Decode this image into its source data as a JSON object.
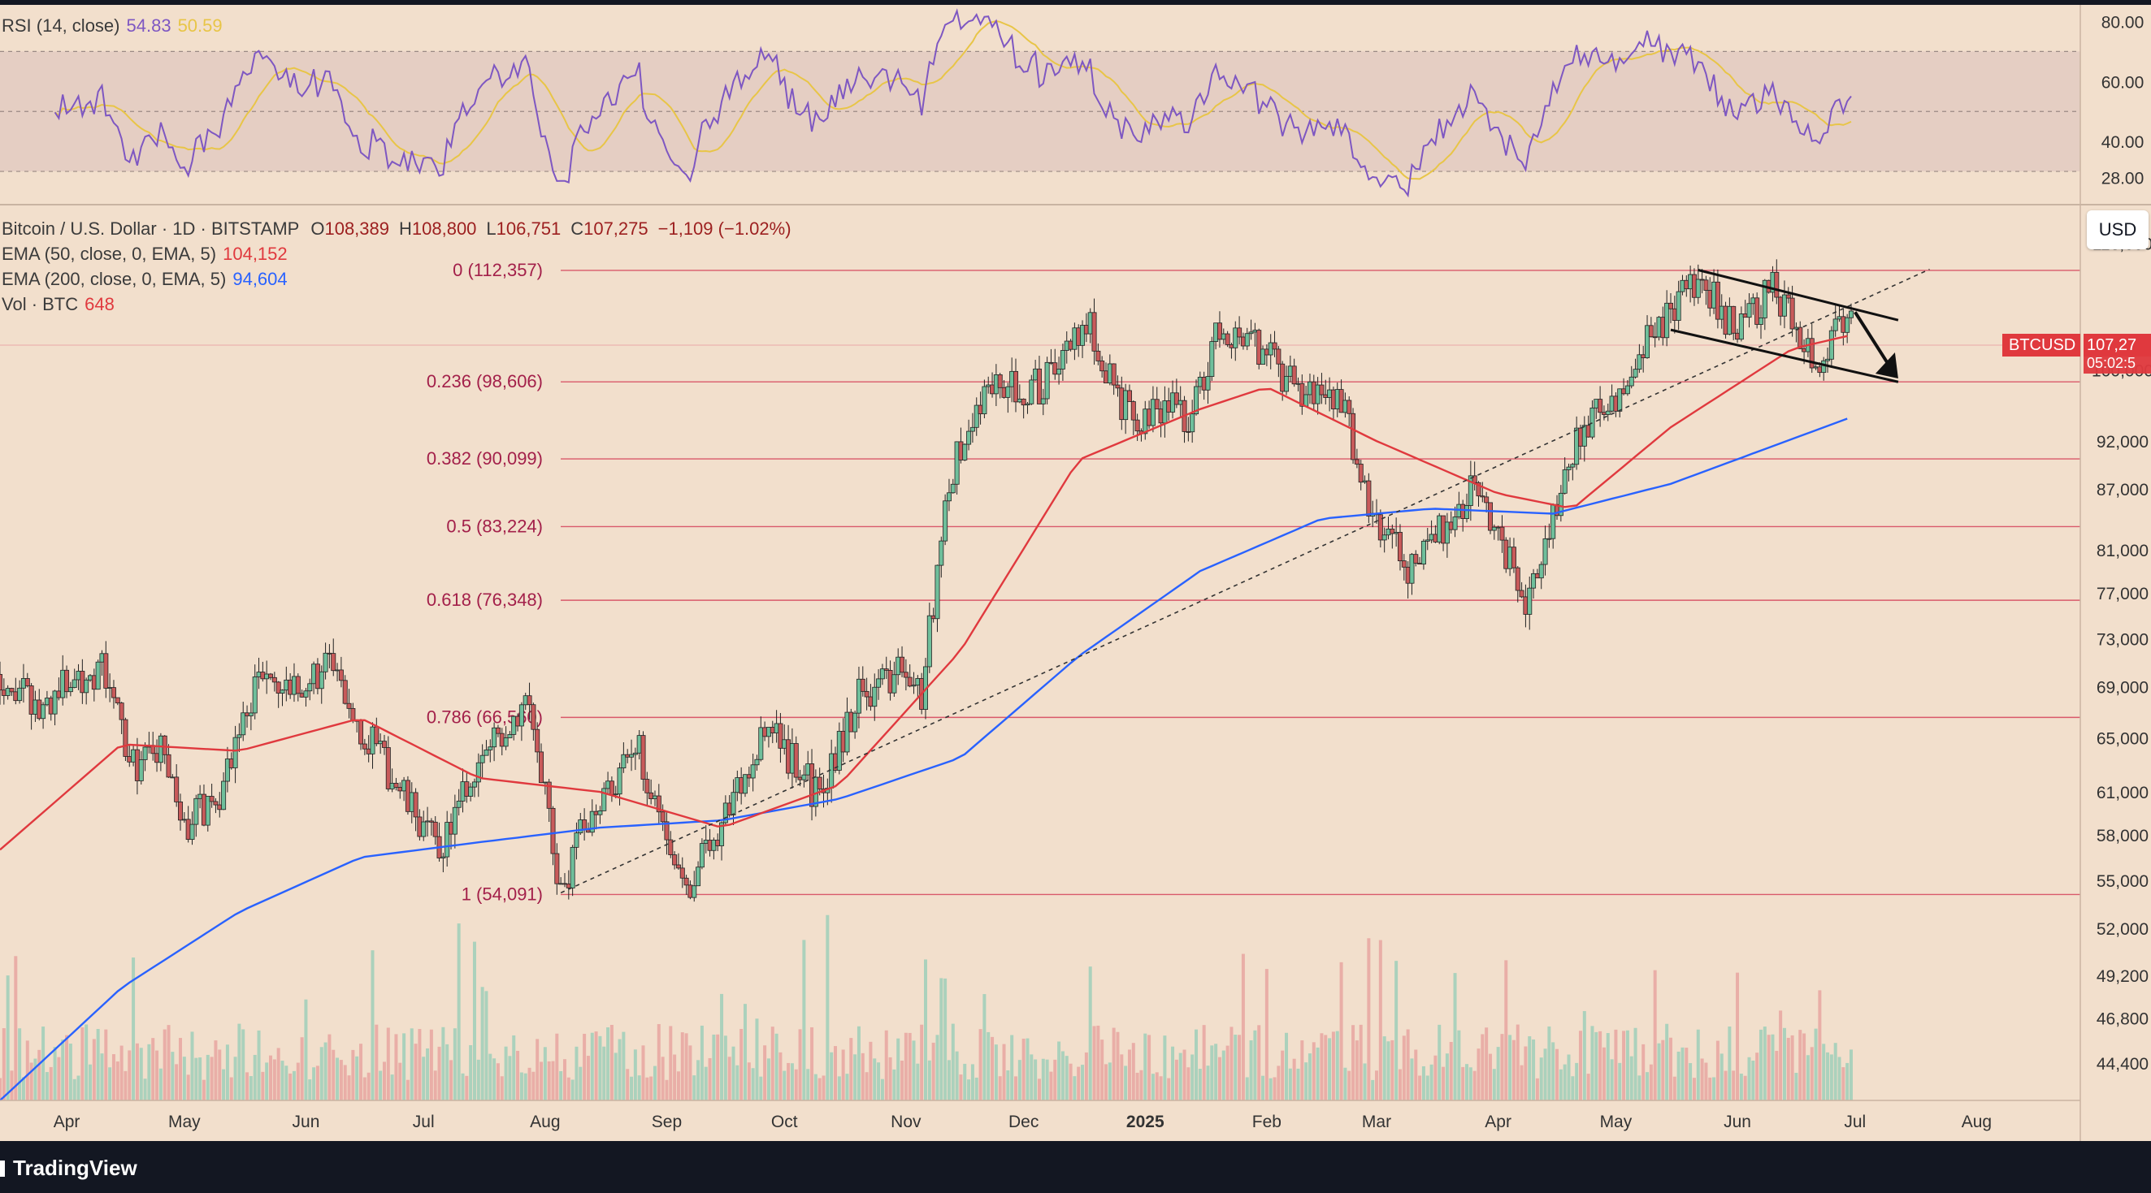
{
  "rsi": {
    "title": "RSI (14, close)",
    "value": "54.83",
    "ma_value": "50.59",
    "levels": [
      "80.00",
      "60.00",
      "40.00",
      "28.00"
    ],
    "colors": {
      "rsi": "#7e57c2",
      "ma": "#e8c547",
      "band": "#e0c8c0"
    }
  },
  "main": {
    "symbol_line": "Bitcoin / U.S. Dollar · 1D · BITSTAMP",
    "ohlc": {
      "open_label": "O",
      "open": "108,389",
      "high_label": "H",
      "high": "108,800",
      "low_label": "L",
      "low": "106,751",
      "close_label": "C",
      "close": "107,275",
      "change": "−1,109 (−1.02%)"
    },
    "ema50": {
      "label": "EMA (50, close, 0, EMA, 5)",
      "value": "104,152",
      "color": "#e0393e"
    },
    "ema200": {
      "label": "EMA (200, close, 0, EMA, 5)",
      "value": "94,604",
      "color": "#2962ff"
    },
    "vol": {
      "label": "Vol · BTC",
      "value": "648"
    },
    "currency_button": "USD",
    "ticker_label": "BTCUSD",
    "last_price": "107,27",
    "countdown": "05:02:5"
  },
  "price_axis": [
    "116,000",
    "100,000",
    "92,000",
    "87,000",
    "81,000",
    "77,000",
    "73,000",
    "69,000",
    "65,000",
    "61,000",
    "58,000",
    "55,000",
    "52,000",
    "49,200",
    "46,800",
    "44,400"
  ],
  "time_axis": [
    "Apr",
    "May",
    "Jun",
    "Jul",
    "Aug",
    "Sep",
    "Oct",
    "Nov",
    "Dec",
    "2025",
    "Feb",
    "Mar",
    "Apr",
    "May",
    "Jun",
    "Jul",
    "Aug"
  ],
  "footer": {
    "brand": "TradingView"
  },
  "chart_data": {
    "type": "candlestick",
    "x_range": [
      "2024-03-15",
      "2025-08-15"
    ],
    "y_axis_scale": "log",
    "ylim": [
      42500,
      121000
    ],
    "fibonacci_levels": [
      {
        "label": "0 (112,357)",
        "value": 112357
      },
      {
        "label": "0.236 (98,606)",
        "value": 98606
      },
      {
        "label": "0.382 (90,099)",
        "value": 90099
      },
      {
        "label": "0.5 (83,224)",
        "value": 83224
      },
      {
        "label": "0.618 (76,348)",
        "value": 76348
      },
      {
        "label": "0.786 (66,560)",
        "value": 66560
      },
      {
        "label": "1 (54,091)",
        "value": 54091
      }
    ],
    "price_path": [
      [
        "2024-03-15",
        70000
      ],
      [
        "2024-03-25",
        67000
      ],
      [
        "2024-04-01",
        69500
      ],
      [
        "2024-04-10",
        70500
      ],
      [
        "2024-04-18",
        63000
      ],
      [
        "2024-04-25",
        64000
      ],
      [
        "2024-05-01",
        58500
      ],
      [
        "2024-05-10",
        61000
      ],
      [
        "2024-05-20",
        70000
      ],
      [
        "2024-05-28",
        68000
      ],
      [
        "2024-06-06",
        71000
      ],
      [
        "2024-06-15",
        66000
      ],
      [
        "2024-06-25",
        61000
      ],
      [
        "2024-07-05",
        57000
      ],
      [
        "2024-07-15",
        63000
      ],
      [
        "2024-07-28",
        68500
      ],
      [
        "2024-08-05",
        54000
      ],
      [
        "2024-08-12",
        59500
      ],
      [
        "2024-08-25",
        64000
      ],
      [
        "2024-09-06",
        54500
      ],
      [
        "2024-09-15",
        59000
      ],
      [
        "2024-09-27",
        65800
      ],
      [
        "2024-10-10",
        60500
      ],
      [
        "2024-10-20",
        68500
      ],
      [
        "2024-10-31",
        70000
      ],
      [
        "2024-11-05",
        68500
      ],
      [
        "2024-11-12",
        88000
      ],
      [
        "2024-11-22",
        98500
      ],
      [
        "2024-12-05",
        98000
      ],
      [
        "2024-12-17",
        106000
      ],
      [
        "2024-12-30",
        92500
      ],
      [
        "2025-01-07",
        96500
      ],
      [
        "2025-01-13",
        94500
      ],
      [
        "2025-01-20",
        105500
      ],
      [
        "2025-01-31",
        102000
      ],
      [
        "2025-02-10",
        97000
      ],
      [
        "2025-02-20",
        97000
      ],
      [
        "2025-02-28",
        84000
      ],
      [
        "2025-03-10",
        79000
      ],
      [
        "2025-03-20",
        84500
      ],
      [
        "2025-03-27",
        87500
      ],
      [
        "2025-04-08",
        76500
      ],
      [
        "2025-04-15",
        84500
      ],
      [
        "2025-04-22",
        93500
      ],
      [
        "2025-05-01",
        96500
      ],
      [
        "2025-05-10",
        104000
      ],
      [
        "2025-05-22",
        111500
      ],
      [
        "2025-06-01",
        104500
      ],
      [
        "2025-06-10",
        110000
      ],
      [
        "2025-06-22",
        101000
      ],
      [
        "2025-06-30",
        107275
      ]
    ],
    "ema50": [
      [
        "2024-03-15",
        57000
      ],
      [
        "2024-04-15",
        64500
      ],
      [
        "2024-05-15",
        64000
      ],
      [
        "2024-06-15",
        66500
      ],
      [
        "2024-07-15",
        62000
      ],
      [
        "2024-08-15",
        61000
      ],
      [
        "2024-09-15",
        58500
      ],
      [
        "2024-10-15",
        61500
      ],
      [
        "2024-11-15",
        72000
      ],
      [
        "2024-12-15",
        90000
      ],
      [
        "2025-01-15",
        95500
      ],
      [
        "2025-02-01",
        98000
      ],
      [
        "2025-03-01",
        92000
      ],
      [
        "2025-04-01",
        86500
      ],
      [
        "2025-04-20",
        85000
      ],
      [
        "2025-05-15",
        93500
      ],
      [
        "2025-06-15",
        102500
      ],
      [
        "2025-06-30",
        104152
      ]
    ],
    "ema200": [
      [
        "2024-03-15",
        42500
      ],
      [
        "2024-04-15",
        48500
      ],
      [
        "2024-05-15",
        53000
      ],
      [
        "2024-06-15",
        56500
      ],
      [
        "2024-07-15",
        57500
      ],
      [
        "2024-08-15",
        58500
      ],
      [
        "2024-09-15",
        59000
      ],
      [
        "2024-10-15",
        60500
      ],
      [
        "2024-11-15",
        63500
      ],
      [
        "2024-12-15",
        71500
      ],
      [
        "2025-01-15",
        79000
      ],
      [
        "2025-02-15",
        84000
      ],
      [
        "2025-03-15",
        85000
      ],
      [
        "2025-04-15",
        84500
      ],
      [
        "2025-05-15",
        87500
      ],
      [
        "2025-06-30",
        94604
      ]
    ],
    "trendline": {
      "from": [
        "2024-08-05",
        54200
      ],
      "to": [
        "2025-07-20",
        112500
      ],
      "style": "dashed"
    },
    "channel_upper": {
      "from": [
        "2025-05-22",
        112400
      ],
      "to": [
        "2025-07-12",
        106000
      ]
    },
    "channel_lower": {
      "from": [
        "2025-05-15",
        104800
      ],
      "to": [
        "2025-07-12",
        98600
      ]
    },
    "arrow": {
      "from": [
        "2025-07-01",
        107000
      ],
      "to": [
        "2025-07-12",
        99000
      ]
    },
    "volume_bars": "decorative",
    "rsi_ylim": [
      20,
      85
    ]
  }
}
